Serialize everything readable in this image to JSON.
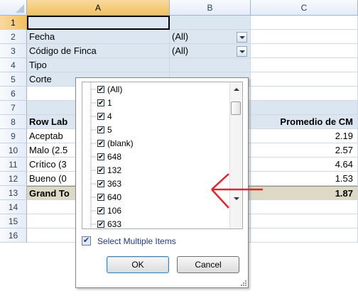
{
  "columns": [
    "A",
    "B",
    "C"
  ],
  "selected_column": "A",
  "rows": [
    "1",
    "2",
    "3",
    "4",
    "5",
    "6",
    "7",
    "8",
    "9",
    "10",
    "11",
    "12",
    "13",
    "14",
    "15",
    "16"
  ],
  "selected_row": "1",
  "filters": [
    {
      "label": "Fecha",
      "value": "(All)"
    },
    {
      "label": "Código de Finca",
      "value": "(All)"
    },
    {
      "label": "Tipo",
      "value": ""
    },
    {
      "label": "Corte",
      "value": ""
    }
  ],
  "pivot": {
    "header_a": "Row Lab",
    "header_c": "Promedio de CM",
    "data_rows": [
      {
        "label": "Aceptab",
        "value": "2.19"
      },
      {
        "label": "Malo (2.5",
        "value": "2.57"
      },
      {
        "label": "Crítico (3",
        "value": "4.64"
      },
      {
        "label": "Bueno (0",
        "value": "1.53"
      }
    ],
    "grand_total_label": "Grand To",
    "grand_total_value": "1.87"
  },
  "filter_popup": {
    "items": [
      "(All)",
      "1",
      "4",
      "5",
      "(blank)",
      "648",
      "132",
      "363",
      "640",
      "106",
      "633"
    ],
    "checkmark": "✔",
    "select_multiple_label": "Select Multiple Items",
    "ok_label": "OK",
    "cancel_label": "Cancel"
  },
  "annotation": {
    "color": "#e8212a"
  }
}
